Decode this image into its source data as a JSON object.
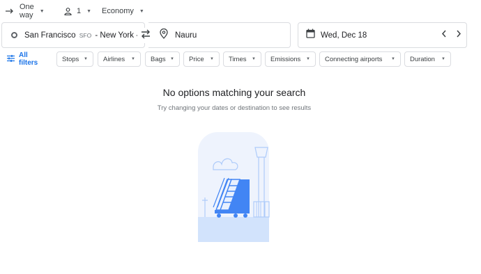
{
  "options": {
    "trip_type": "One way",
    "passengers": "1",
    "cabin_class": "Economy"
  },
  "search": {
    "origin_city": "San Francisco",
    "origin_code": "SFO",
    "origin_rest": "- New York - ...",
    "destination": "Nauru",
    "date": "Wed, Dec 18"
  },
  "filters": {
    "all_filters_label": "All filters",
    "chips": [
      "Stops",
      "Airlines",
      "Bags",
      "Price",
      "Times",
      "Emissions",
      "Connecting airports",
      "Duration"
    ]
  },
  "empty_state": {
    "title": "No options matching your search",
    "subtitle": "Try changing your dates or destination to see results"
  },
  "colors": {
    "accent": "#1a73e8",
    "border": "#dadce0",
    "illustration_bg": "#e8f0fe",
    "illustration_blue": "#4285f4"
  },
  "icons": [
    "arrow-right-icon",
    "person-icon",
    "swap-icon",
    "location-pin-icon",
    "calendar-icon",
    "chevron-left-icon",
    "chevron-right-icon",
    "tune-icon"
  ]
}
